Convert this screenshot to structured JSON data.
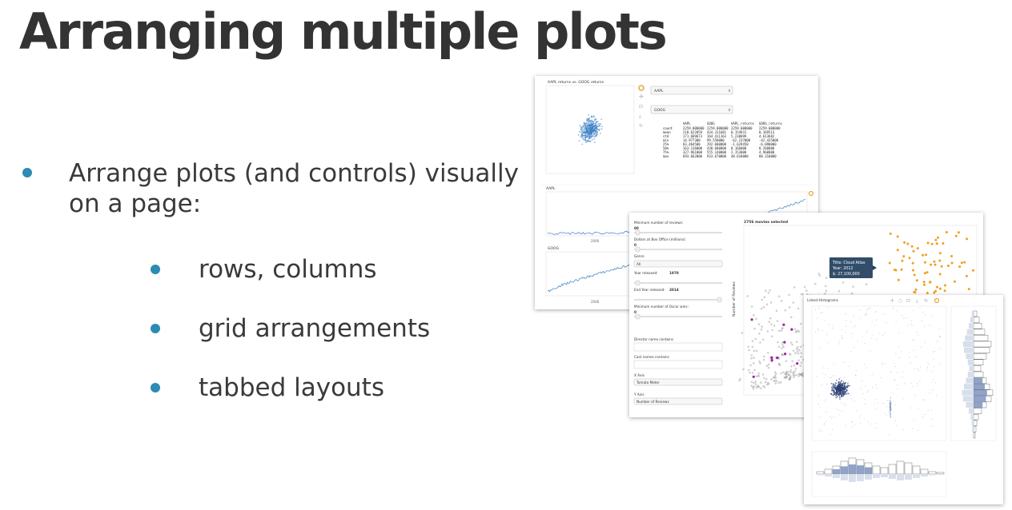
{
  "slide": {
    "title": "Arranging multiple plots",
    "bullets": [
      "Arrange plots (and controls) visually on a page:"
    ],
    "sub_bullets": [
      "rows, columns",
      "grid arrangements",
      "tabbed layouts"
    ]
  },
  "screenshots": {
    "stocks": {
      "scatter_title": "AAPL returns vs. GOOG returns",
      "ticker1": "AAPL",
      "ticker2": "GOOG",
      "stats_header": [
        "AAPL",
        "GOOG",
        "AAPL_returns",
        "GOOG_returns"
      ],
      "stats_rows": [
        [
          "count",
          "2259.000000",
          "2259.000000",
          "2259.000000",
          "2259.000000"
        ],
        [
          "mean",
          "218.622859",
          "434.311681",
          "0.154931",
          "0.169513"
        ],
        [
          "std",
          "171.689673",
          "164.411163",
          "5.238099",
          "4.613682"
        ],
        [
          "min",
          "14.977300",
          "99.550000",
          "-62.237000",
          "-42.435000"
        ],
        [
          "25%",
          "83.464500",
          "292.600000",
          "-1.629450",
          "-6.090000"
        ],
        [
          "50%",
          "163.136000",
          "438.600000",
          "0.166000",
          "0.260000"
        ],
        [
          "75%",
          "327.961000",
          "555.140000",
          "2.153000",
          "4.960000"
        ],
        [
          "max",
          "693.662000",
          "933.670000",
          "48.618000",
          "88.310000"
        ]
      ],
      "ts1_title": "AAPL",
      "ts2_title": "GOOG",
      "year_label": "2006"
    },
    "movies": {
      "controls": [
        {
          "label": "Minimum number of reviews:",
          "value": "80"
        },
        {
          "label": "Dollars at Box Office (millions):",
          "value": "0"
        },
        {
          "label": "Genre",
          "value": ""
        },
        {
          "label": "Year released:",
          "value": "1970"
        },
        {
          "label": "End Year released:",
          "value": "2014"
        },
        {
          "label": "Minimum number of Oscar wins:",
          "value": "0"
        }
      ],
      "genre_value": "All",
      "director_label": "Director name contains",
      "cast_label": "Cast names contains",
      "xaxis_label": "X Axis",
      "xaxis_value": "Tomato Meter",
      "yaxis_label": "Y Axis",
      "yaxis_value": "Number of Reviews",
      "plot_title": "2756 movies selected",
      "ylabel": "Number of Reviews",
      "tooltip": {
        "title": "Title: Cloud Atlas",
        "year": "Year: 2012",
        "money": "$: 27,100,000"
      }
    },
    "hist": {
      "title": "Linked Histograms"
    }
  }
}
